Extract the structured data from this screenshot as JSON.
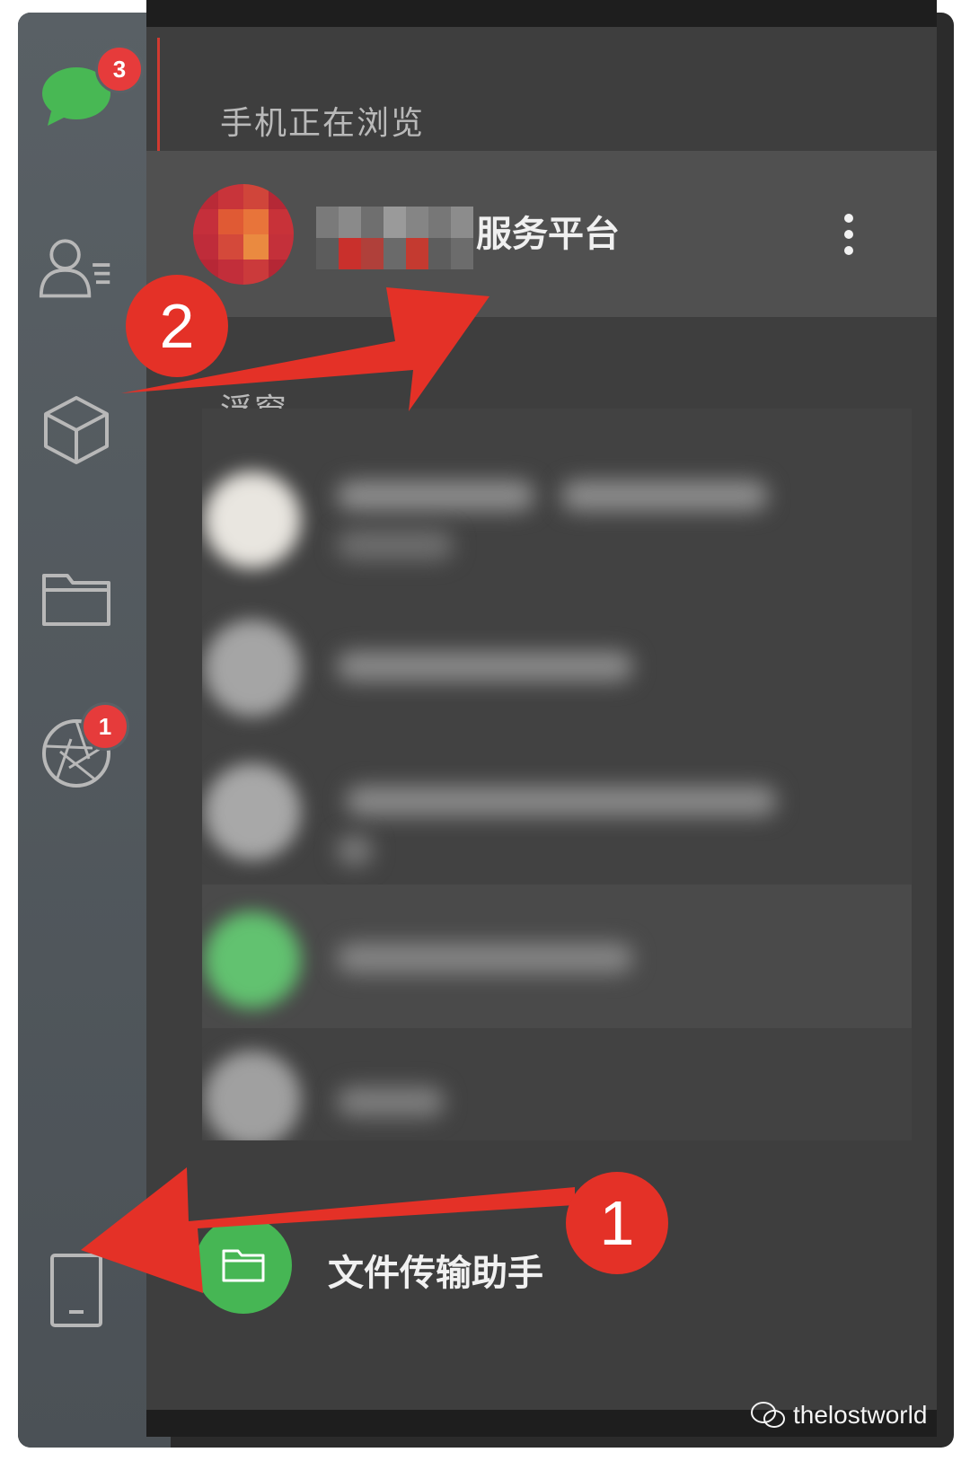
{
  "sidebar": {
    "chat_badge": "3",
    "moments_badge": "1",
    "icons": [
      "chat-icon",
      "contacts-icon",
      "miniprogram-cube-icon",
      "folder-icon",
      "moments-shutter-icon",
      "phone-icon"
    ]
  },
  "panel": {
    "browsing_label": "手机正在浏览",
    "browsing_item_title": "服务平台",
    "floating_label": "浮窗",
    "file_helper_title": "文件传输助手"
  },
  "annotations": {
    "step_one": "1",
    "step_two": "2"
  },
  "watermark": "thelostworld",
  "colors": {
    "sidebar": "#565d62",
    "panel": "#3e3e3e",
    "accent_red": "#e43127",
    "wechat_green": "#46b654",
    "badge_red": "#e63b3b"
  }
}
